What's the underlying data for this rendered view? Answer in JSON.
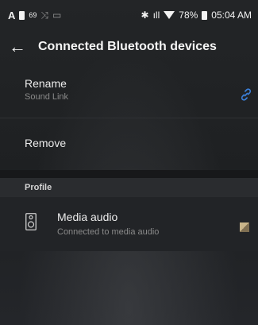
{
  "status_bar": {
    "left_letter": "A",
    "notif_count": "69",
    "battery_percent": "78%",
    "time": "05:04 AM"
  },
  "app_bar": {
    "title": "Connected Bluetooth devices"
  },
  "rename": {
    "label": "Rename",
    "value": "Sound Link"
  },
  "remove": {
    "label": "Remove"
  },
  "profile_section": {
    "header": "Profile",
    "items": [
      {
        "label": "Media audio",
        "subtitle": "Connected to media audio",
        "icon": "speaker-icon",
        "checked": true
      }
    ]
  },
  "colors": {
    "accent": "#3b7fd9",
    "checkbox_gold": "#c9b58a",
    "background": "#202224"
  }
}
